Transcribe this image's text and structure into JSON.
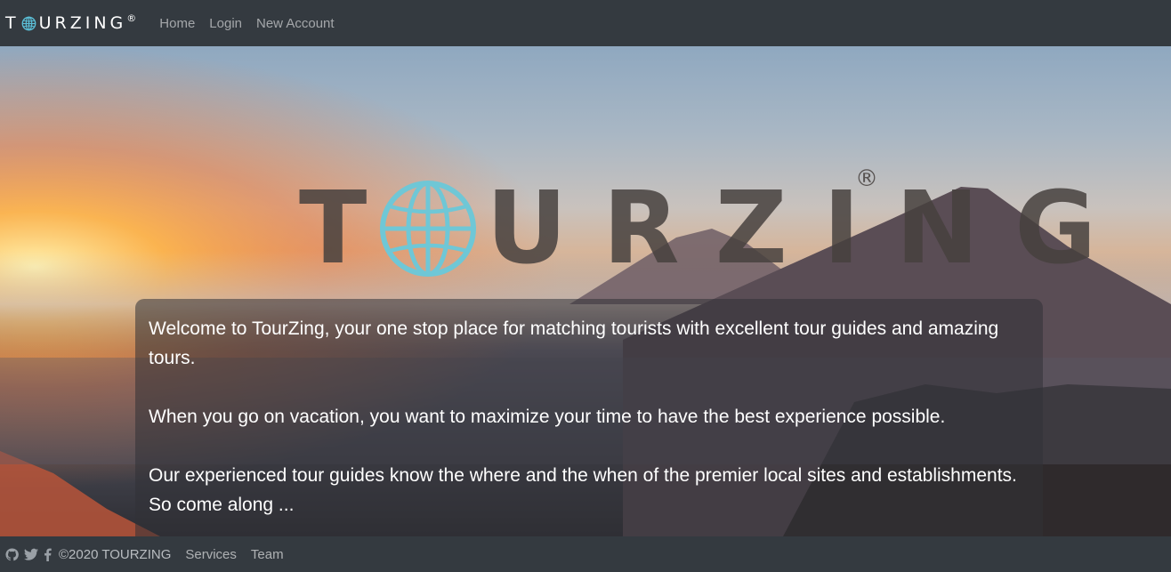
{
  "navbar": {
    "brand_left": "T",
    "brand_right": "URZING",
    "brand_reg": "®",
    "links": [
      "Home",
      "Login",
      "New Account"
    ]
  },
  "hero": {
    "logo_letters": [
      "T",
      "U",
      "R",
      "Z",
      "I",
      "N",
      "G"
    ],
    "logo_reg": "®",
    "welcome": {
      "p1": "Welcome to TourZing, your one stop place for matching tourists with excellent tour guides and amazing tours.",
      "p2": "When you go on vacation, you want to maximize your time to have the best experience possible.",
      "p3": "Our experienced tour guides know the where and the when of the premier local sites and establishments. So come along ..."
    }
  },
  "footer": {
    "icons": [
      "github-icon",
      "twitter-icon",
      "facebook-icon"
    ],
    "copyright": "©2020 TOURZING",
    "links": [
      "Services",
      "Team"
    ]
  },
  "colors": {
    "navbar_bg": "#343a40",
    "globe": "#6fc7d6"
  }
}
